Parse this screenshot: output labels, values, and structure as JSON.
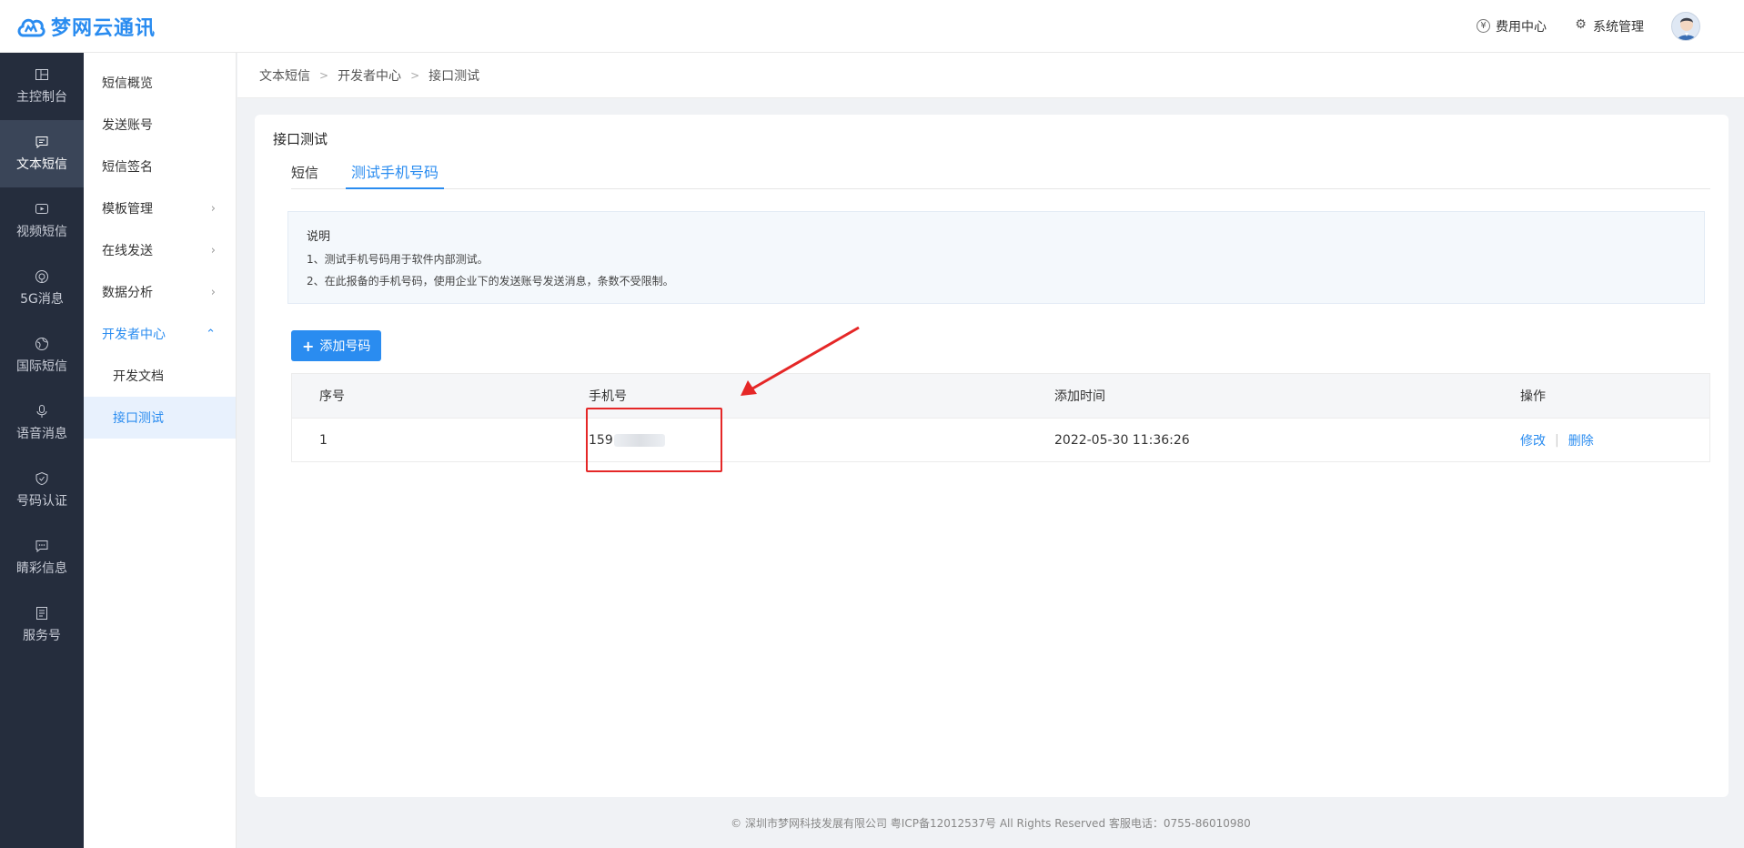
{
  "header": {
    "logo_text": "梦网云通讯",
    "fees_label": "费用中心",
    "fees_icon": "yen-icon",
    "fees_icon_glyph": "¥",
    "system_label": "系统管理",
    "system_icon": "gear-icon",
    "system_icon_glyph": "⚙"
  },
  "main_nav": [
    {
      "label": "主控制台",
      "icon": "dashboard-icon"
    },
    {
      "label": "文本短信",
      "icon": "message-icon",
      "active": true
    },
    {
      "label": "视频短信",
      "icon": "video-icon"
    },
    {
      "label": "5G消息",
      "icon": "5g-icon"
    },
    {
      "label": "国际短信",
      "icon": "globe-icon"
    },
    {
      "label": "语音消息",
      "icon": "microphone-icon"
    },
    {
      "label": "号码认证",
      "icon": "shield-icon"
    },
    {
      "label": "睛彩信息",
      "icon": "chat-icon"
    },
    {
      "label": "服务号",
      "icon": "document-icon"
    }
  ],
  "sub_nav": [
    {
      "label": "短信概览"
    },
    {
      "label": "发送账号"
    },
    {
      "label": "短信签名"
    },
    {
      "label": "模板管理",
      "chevron": "›"
    },
    {
      "label": "在线发送",
      "chevron": "›"
    },
    {
      "label": "数据分析",
      "chevron": "›"
    },
    {
      "label": "开发者中心",
      "chevron": "⌃",
      "open": true
    },
    {
      "label": "开发文档",
      "child": true
    },
    {
      "label": "接口测试",
      "child": true,
      "selected": true
    }
  ],
  "breadcrumb": [
    "文本短信",
    "开发者中心",
    "接口测试"
  ],
  "breadcrumb_sep": ">",
  "card": {
    "title": "接口测试",
    "tabs": [
      {
        "label": "短信",
        "active": false
      },
      {
        "label": "测试手机号码",
        "active": true
      }
    ],
    "notice": {
      "title": "说明",
      "lines": [
        "1、测试手机号码用于软件内部测试。",
        "2、在此报备的手机号码，使用企业下的发送账号发送消息，条数不受限制。"
      ]
    },
    "add_button": {
      "icon_glyph": "+",
      "label": "添加号码"
    },
    "table": {
      "columns": [
        "序号",
        "手机号",
        "添加时间",
        "操作"
      ],
      "rows": [
        {
          "index": "1",
          "phone_prefix": "159",
          "added_at": "2022-05-30 11:36:26",
          "edit": "修改",
          "delete": "删除"
        }
      ],
      "action_divider": "|"
    }
  },
  "footer": "© 深圳市梦网科技发展有限公司 粤ICP备12012537号 All Rights Reserved 客服电话：0755-86010980",
  "colors": {
    "accent": "#2a8cf0",
    "sidebar_dark": "#252d3d",
    "annotation": "#e52727"
  }
}
